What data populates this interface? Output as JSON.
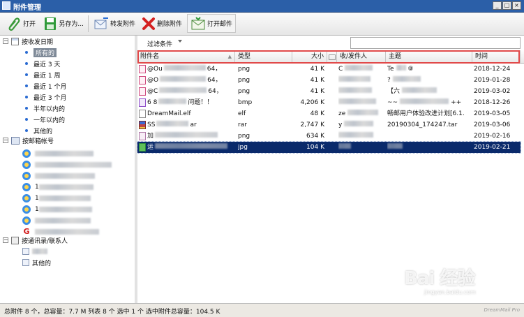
{
  "window": {
    "title": "附件管理",
    "buttons": [
      "_",
      "□",
      "×"
    ]
  },
  "toolbar": {
    "open_label": "打开",
    "saveas_label": "另存为...",
    "forward_label": "转发附件",
    "delete_label": "删除附件",
    "openmail_label": "打开邮件"
  },
  "sidebar": {
    "group_date": "按收发日期",
    "date_items": [
      "所有的",
      "最近 3 天",
      "最近 1 周",
      "最近 1 个月",
      "最近 3 个月",
      "半年以内的",
      "一年以内的",
      "其他的"
    ],
    "group_account": "按邮箱帐号",
    "account_prefixes": [
      "",
      "",
      "",
      "1",
      "1",
      "1",
      "",
      ""
    ],
    "group_contacts": "按通讯录/联系人",
    "contact_items": [
      "",
      "其他的"
    ]
  },
  "filter": {
    "label": "过滤条件"
  },
  "columns": {
    "name": "附件名",
    "type": "类型",
    "size": "大小",
    "sender": "收/发件人",
    "subject": "主题",
    "time": "时间"
  },
  "rows": [
    {
      "name": "@Ou",
      "name_tail": "64，",
      "type": "png",
      "size": "41 K",
      "sender": "C",
      "subject": "Te",
      "subject_tail": "⑧",
      "time": "2018-12-24"
    },
    {
      "name": "@O",
      "name_tail": "64，",
      "type": "png",
      "size": "41 K",
      "sender": "",
      "subject": "?",
      "subject_tail": "",
      "time": "2019-01-28"
    },
    {
      "name": "@C",
      "name_tail": "64，",
      "type": "png",
      "size": "41 K",
      "sender": "",
      "subject": "【六",
      "subject_tail": "",
      "time": "2019-03-02"
    },
    {
      "name": "6  8",
      "name_tail": "问题！！",
      "type": "bmp",
      "size": "4,206 K",
      "sender": "",
      "subject": "~~",
      "subject_tail": "++",
      "time": "2018-12-26"
    },
    {
      "name": "DreamMail.elf",
      "name_tail": "",
      "type": "elf",
      "size": "48 K",
      "sender": "ze",
      "subject": "畅邮用户体验改进计划[6.1.",
      "subject_tail": "",
      "time": "2019-03-05"
    },
    {
      "name": "SS",
      "name_tail": "ar",
      "type": "rar",
      "size": "2,747 K",
      "sender": "y",
      "subject": "20190304_174247.tar",
      "subject_tail": "",
      "time": "2019-03-06"
    },
    {
      "name": "加",
      "name_tail": "",
      "type": "png",
      "size": "634 K",
      "sender": "",
      "subject": "",
      "subject_tail": "",
      "time": "2019-02-16"
    },
    {
      "name": "运",
      "name_tail": "",
      "type": "jpg",
      "size": "104 K",
      "sender": "",
      "subject": "",
      "subject_tail": "",
      "time": "2019-02-21"
    }
  ],
  "status": {
    "text": "总附件 8 个，总容量：7.7 M   列表 8 个  选中 1 个  选中附件总容量：104.5 K",
    "brand": "DreamMail Pro"
  },
  "watermark": {
    "main": "Bai 经验",
    "sub": "jingyan.baidu.com"
  }
}
